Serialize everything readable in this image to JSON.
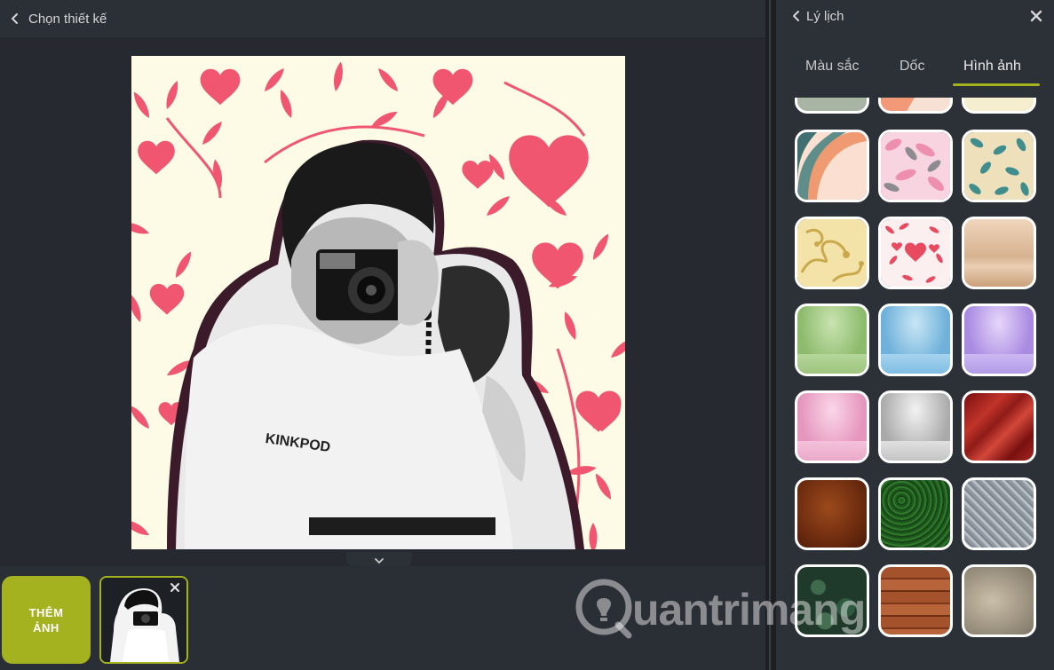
{
  "editor": {
    "back_title": "Chọn thiết kế",
    "add_button": {
      "line1": "THÊM",
      "line2": "ẢNH"
    }
  },
  "background_panel": {
    "title": "Lý lịch",
    "tabs": [
      {
        "label": "Màu sắc",
        "active": false
      },
      {
        "label": "Dốc",
        "active": false
      },
      {
        "label": "Hình ảnh",
        "active": true
      }
    ],
    "accent_color": "#a4b21f",
    "tiles": [
      {
        "name": "tile-pastel-sage",
        "kind": "partial"
      },
      {
        "name": "tile-pastel-arcs",
        "kind": "partial"
      },
      {
        "name": "tile-pastel-cream",
        "kind": "partial"
      },
      {
        "name": "tile-abstract-waves"
      },
      {
        "name": "tile-pink-leaves"
      },
      {
        "name": "tile-teal-leaves"
      },
      {
        "name": "tile-gold-swirls"
      },
      {
        "name": "tile-red-hearts-leaves"
      },
      {
        "name": "tile-beige-studio"
      },
      {
        "name": "tile-green-studio"
      },
      {
        "name": "tile-blue-studio"
      },
      {
        "name": "tile-purple-studio"
      },
      {
        "name": "tile-pink-studio"
      },
      {
        "name": "tile-grey-studio"
      },
      {
        "name": "tile-red-satin"
      },
      {
        "name": "tile-brown-leather"
      },
      {
        "name": "tile-green-grass"
      },
      {
        "name": "tile-grey-fabric"
      },
      {
        "name": "tile-dark-leaves"
      },
      {
        "name": "tile-wood-planks"
      },
      {
        "name": "tile-concrete-wall"
      }
    ]
  },
  "watermark": {
    "text": "uantrimang",
    "logo": "bulb-q-icon"
  },
  "icons": {
    "back": "chevron-left-icon",
    "close": "close-icon",
    "collapse": "chevron-down-icon",
    "remove_photo": "close-icon"
  }
}
